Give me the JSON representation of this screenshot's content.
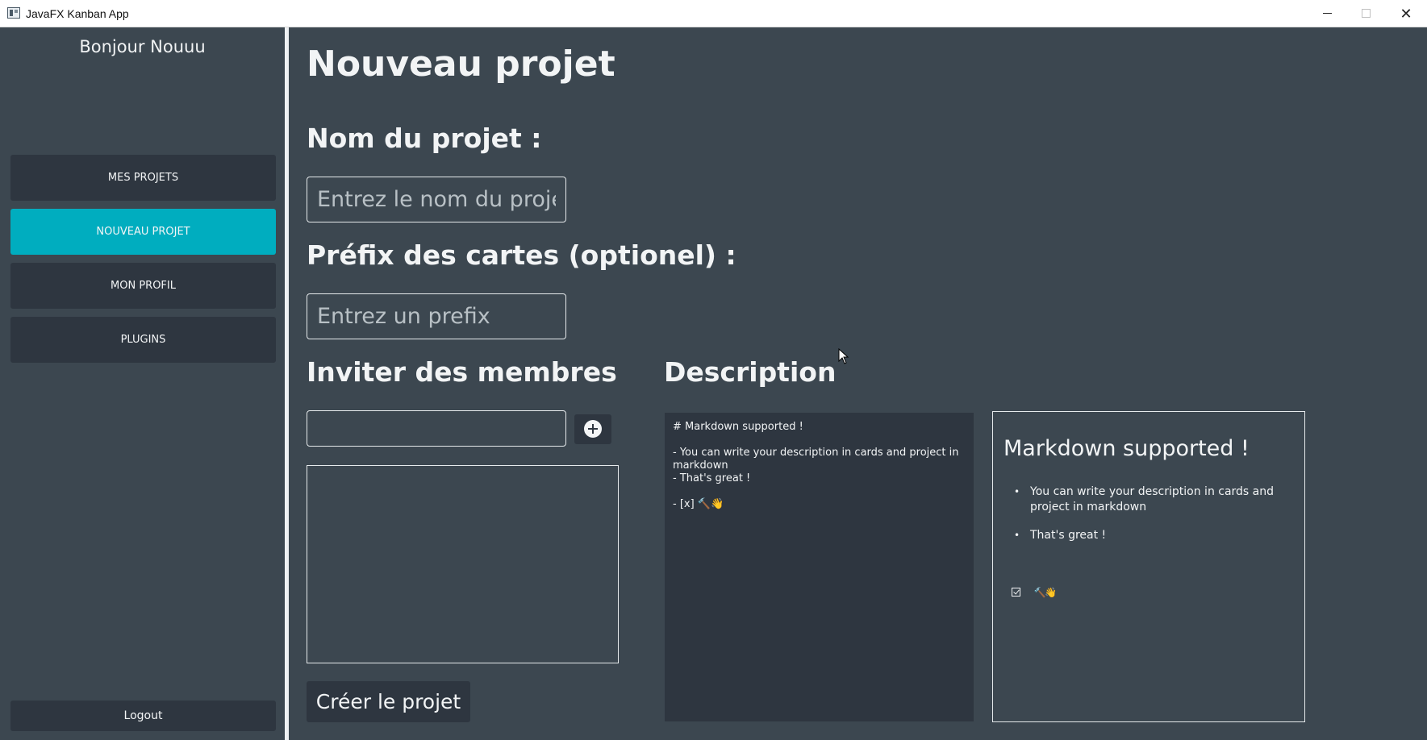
{
  "window": {
    "title": "JavaFX Kanban App",
    "controls": {
      "minimize": "minimize-icon",
      "maximize": "maximize-icon",
      "close": "✕"
    }
  },
  "sidebar": {
    "greeting": "Bonjour Nouuu",
    "items": [
      {
        "label": "MES PROJETS",
        "active": false
      },
      {
        "label": "NOUVEAU PROJET",
        "active": true
      },
      {
        "label": "MON PROFIL",
        "active": false
      },
      {
        "label": "PLUGINS",
        "active": false
      }
    ],
    "logout_label": "Logout",
    "active_color": "#00adbf"
  },
  "main": {
    "title": "Nouveau projet",
    "name_label": "Nom du projet :",
    "name_placeholder": "Entrez le nom du projet",
    "prefix_label": "Préfix des cartes (optionel) :",
    "prefix_placeholder": "Entrez un prefix",
    "invite_label": "Inviter des membres",
    "invite_value": "",
    "add_icon": "plus-circle-icon",
    "description_label": "Description",
    "description_source": "# Markdown supported !\n\n- You can write your description in cards and project in markdown\n- That's great !\n\n- [x] 🔨👋",
    "preview": {
      "heading": "Markdown supported !",
      "items": [
        "You can write your description in cards and project in markdown",
        "That's great !"
      ],
      "task_text": "🔨👋",
      "task_checked": true
    },
    "create_label": "Créer le projet"
  }
}
